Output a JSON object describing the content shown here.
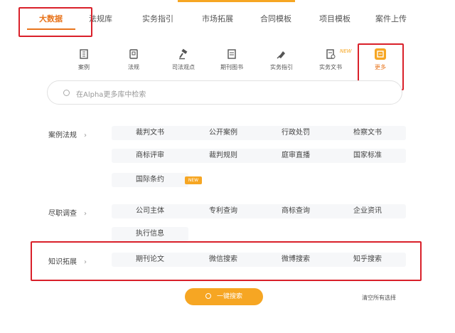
{
  "colors": {
    "accent": "#e8741c",
    "accent_light": "#f6a623",
    "annotation_red": "#d9202a"
  },
  "tabs": [
    {
      "label": "大数据",
      "active": true
    },
    {
      "label": "法规库",
      "active": false
    },
    {
      "label": "实务指引",
      "active": false
    },
    {
      "label": "市场拓展",
      "active": false
    },
    {
      "label": "合同模板",
      "active": false
    },
    {
      "label": "项目模板",
      "active": false
    },
    {
      "label": "案件上传",
      "active": false
    }
  ],
  "icons": [
    {
      "label": "案例",
      "icon": "building-icon"
    },
    {
      "label": "法规",
      "icon": "law-book-icon"
    },
    {
      "label": "司法观点",
      "icon": "gavel-icon"
    },
    {
      "label": "期刊图书",
      "icon": "journal-icon"
    },
    {
      "label": "实务指引",
      "icon": "guide-icon"
    },
    {
      "label": "实务文书",
      "icon": "document-icon"
    },
    {
      "label": "更多",
      "icon": "more-icon",
      "selected": true
    }
  ],
  "new_tag": "NEW",
  "search": {
    "placeholder": "在Alpha更多库中检索"
  },
  "categories": [
    {
      "label": "案例法规",
      "items": [
        "裁判文书",
        "公开案例",
        "行政处罚",
        "检察文书",
        "商标评审",
        "裁判规则",
        "庭审直播",
        "国家标准",
        "国际条约"
      ]
    },
    {
      "label": "尽职调查",
      "items": [
        "公司主体",
        "专利查询",
        "商标查询",
        "企业资讯",
        "执行信息"
      ]
    },
    {
      "label": "知识拓展",
      "items": [
        "期刊论文",
        "微信搜索",
        "微博搜索",
        "知乎搜索"
      ]
    }
  ],
  "hot_badge": "NEW",
  "actions": {
    "search_all": "一键搜索",
    "clear": "清空所有选择"
  }
}
